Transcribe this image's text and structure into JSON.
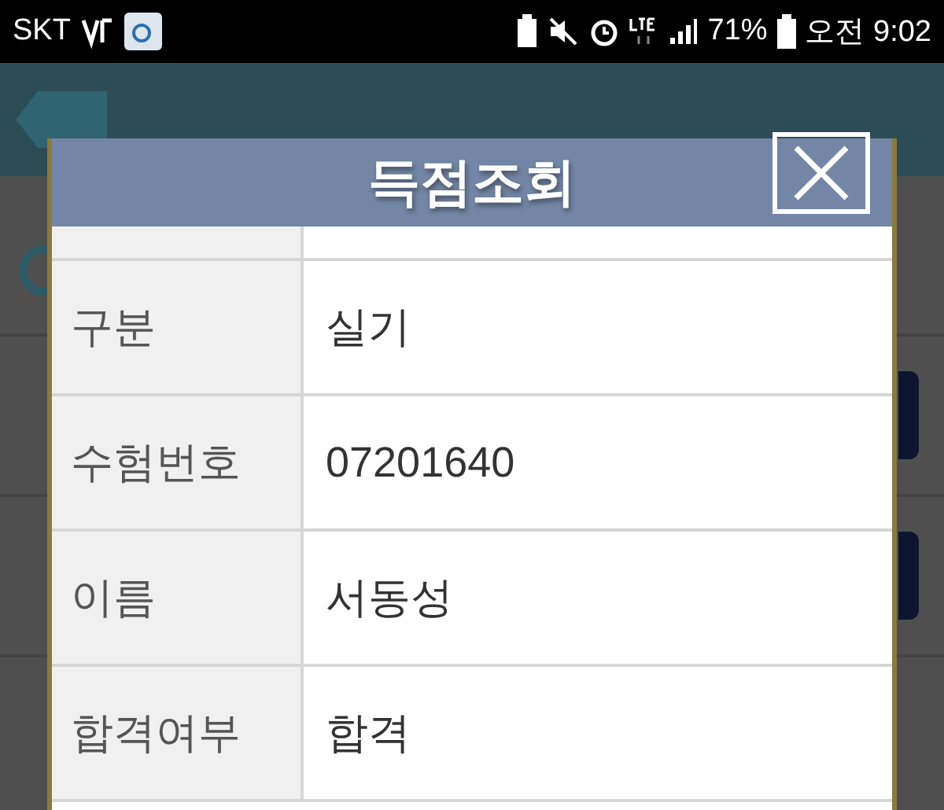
{
  "status_bar": {
    "carrier": "SKT",
    "battery_percent": "71%",
    "time": "오전 9:02"
  },
  "dialog": {
    "title": "득점조회",
    "rows": [
      {
        "label": "구분",
        "value": "실기"
      },
      {
        "label": "수험번호",
        "value": "07201640"
      },
      {
        "label": "이름",
        "value": "서동성"
      },
      {
        "label": "합격여부",
        "value": "합격"
      }
    ]
  }
}
